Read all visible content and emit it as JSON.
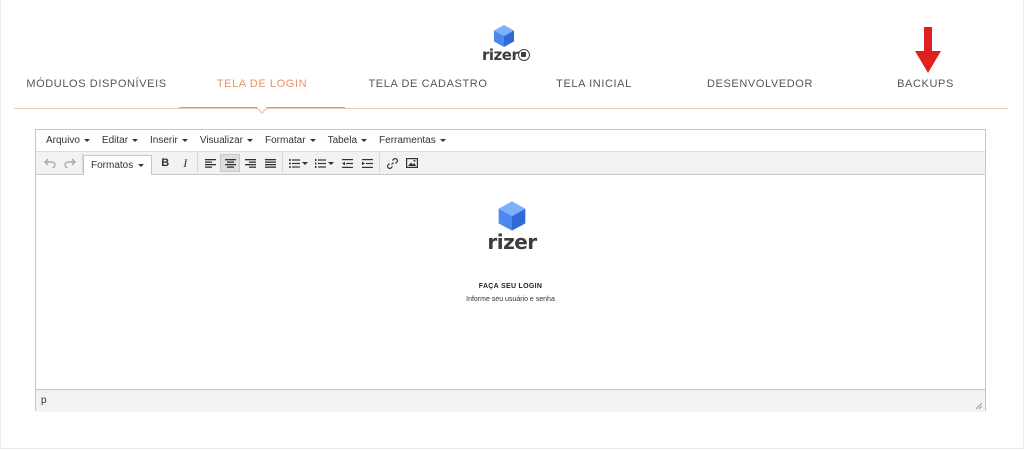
{
  "header": {
    "logo_wordmark": "rizer",
    "brand_colors": {
      "cube_light": "#7fb0ff",
      "cube_mid": "#4a8af0",
      "cube_dark": "#2f6bd8",
      "accent": "#f08e64",
      "arrow": "#e0201e"
    }
  },
  "nav": {
    "tabs": [
      {
        "label": "MÓDULOS DISPONÍVEIS",
        "active": false
      },
      {
        "label": "TELA DE LOGIN",
        "active": true
      },
      {
        "label": "TELA DE CADASTRO",
        "active": false
      },
      {
        "label": "TELA INICIAL",
        "active": false
      },
      {
        "label": "DESENVOLVEDOR",
        "active": false
      },
      {
        "label": "BACKUPS",
        "active": false
      }
    ],
    "highlight_indicator": "arrow-down-icon"
  },
  "editor": {
    "menu": [
      {
        "label": "Arquivo"
      },
      {
        "label": "Editar"
      },
      {
        "label": "Inserir"
      },
      {
        "label": "Visualizar"
      },
      {
        "label": "Formatar"
      },
      {
        "label": "Tabela"
      },
      {
        "label": "Ferramentas"
      }
    ],
    "toolbar": {
      "formats_label": "Formatos",
      "bold_label": "B",
      "italic_label": "I",
      "icons": [
        "undo-icon",
        "redo-icon",
        "align-left-icon",
        "align-center-icon",
        "align-right-icon",
        "align-justify-icon",
        "bullet-list-icon",
        "numbered-list-icon",
        "outdent-icon",
        "indent-icon",
        "link-icon",
        "image-icon"
      ],
      "active_alignment": "center"
    },
    "content": {
      "logo_wordmark": "rizer",
      "heading": "FAÇA SEU LOGIN",
      "subheading": "Informe seu usuário e senha"
    },
    "statusbar": {
      "path": "p"
    }
  }
}
